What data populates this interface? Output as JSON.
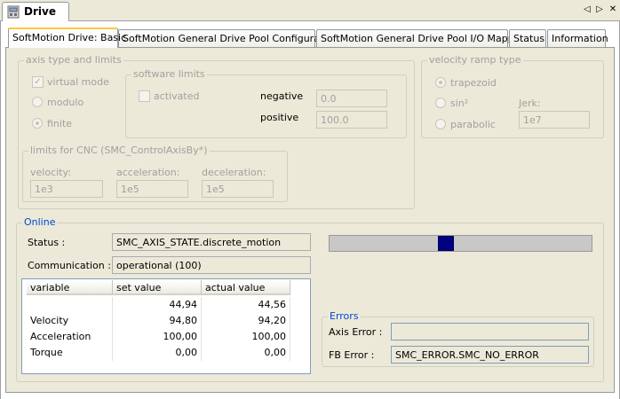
{
  "window": {
    "title": "Drive",
    "prev_label": "◁",
    "next_label": "▷",
    "close_label": "✕"
  },
  "tabs": [
    {
      "label": "SoftMotion Drive: Basic",
      "active": true
    },
    {
      "label": "SoftMotion General Drive Pool Configuration",
      "active": false
    },
    {
      "label": "SoftMotion General Drive Pool I/O Mapping",
      "active": false
    },
    {
      "label": "Status",
      "active": false
    },
    {
      "label": "Information",
      "active": false
    }
  ],
  "axis_group": {
    "legend": "axis type and limits",
    "virtual_mode": {
      "label": "virtual mode",
      "checked": true
    },
    "modulo_label": "modulo",
    "finite_label": "finite",
    "selected": "finite"
  },
  "software_limits": {
    "legend": "software limits",
    "activated_label": "activated",
    "negative_label": "negative",
    "negative_value": "0.0",
    "positive_label": "positive",
    "positive_value": "100.0"
  },
  "cnc_limits": {
    "legend": "limits for CNC (SMC_ControlAxisBy*)",
    "velocity_label": "velocity:",
    "velocity_value": "1e3",
    "acceleration_label": "acceleration:",
    "acceleration_value": "1e5",
    "deceleration_label": "deceleration:",
    "deceleration_value": "1e5"
  },
  "velocity_ramp": {
    "legend": "velocity ramp type",
    "trapezoid_label": "trapezoid",
    "sin2_label": "sin²",
    "parabolic_label": "parabolic",
    "selected": "trapezoid",
    "jerk_label": "Jerk:",
    "jerk_value": "1e7"
  },
  "online": {
    "legend": "Online",
    "status_label": "Status :",
    "status_value": "SMC_AXIS_STATE.discrete_motion",
    "communication_label": "Communication :",
    "communication_value": "operational (100)",
    "position_fraction": 0.44,
    "table": {
      "headers": [
        "variable",
        "set value",
        "actual value"
      ],
      "rows": [
        {
          "variable": "",
          "set": "44,94",
          "actual": "44,56"
        },
        {
          "variable": "Velocity",
          "set": "94,80",
          "actual": "94,20"
        },
        {
          "variable": "Acceleration",
          "set": "100,00",
          "actual": "100,00"
        },
        {
          "variable": "Torque",
          "set": "0,00",
          "actual": "0,00"
        }
      ]
    },
    "errors": {
      "legend": "Errors",
      "axis_error_label": "Axis Error :",
      "axis_error_value": "",
      "fb_error_label": "FB Error :",
      "fb_error_value": "SMC_ERROR.SMC_NO_ERROR"
    }
  },
  "colors": {
    "accent_tab": "#ffc83c",
    "progress_thumb": "#000080",
    "online_legend": "#0046d5"
  },
  "icons": {
    "drive": "drive-icon"
  }
}
